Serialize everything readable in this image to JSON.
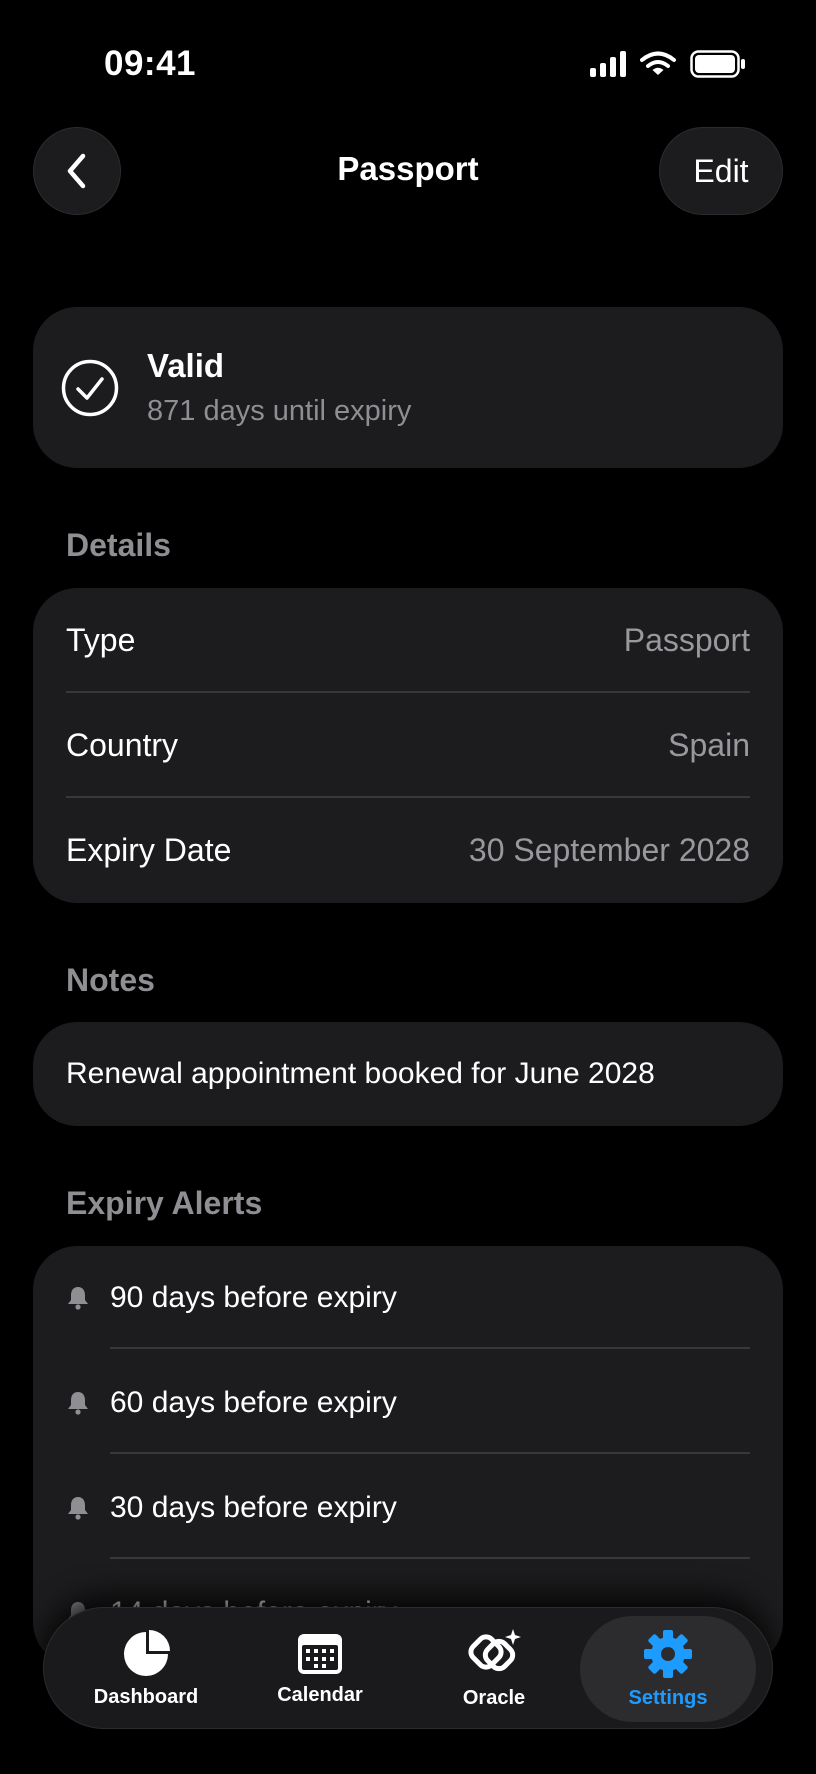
{
  "status_bar": {
    "time": "09:41"
  },
  "nav": {
    "title": "Passport",
    "edit_label": "Edit"
  },
  "status": {
    "title": "Valid",
    "subtitle": "871 days until expiry"
  },
  "details": {
    "header": "Details",
    "rows": [
      {
        "label": "Type",
        "value": "Passport"
      },
      {
        "label": "Country",
        "value": "Spain"
      },
      {
        "label": "Expiry Date",
        "value": "30 September 2028"
      }
    ]
  },
  "notes": {
    "header": "Notes",
    "text": "Renewal appointment booked for June 2028"
  },
  "alerts": {
    "header": "Expiry Alerts",
    "items": [
      {
        "label": "90 days before expiry"
      },
      {
        "label": "60 days before expiry"
      },
      {
        "label": "30 days before expiry"
      },
      {
        "label": "14 days before expiry"
      }
    ]
  },
  "tabs": [
    {
      "label": "Dashboard",
      "icon": "pie-chart-icon"
    },
    {
      "label": "Calendar",
      "icon": "calendar-icon"
    },
    {
      "label": "Oracle",
      "icon": "oracle-icon"
    },
    {
      "label": "Settings",
      "icon": "gear-icon",
      "active": true
    }
  ],
  "colors": {
    "accent": "#1e9bff",
    "card": "#1c1c1e",
    "secondary_text": "#8e8e93"
  }
}
